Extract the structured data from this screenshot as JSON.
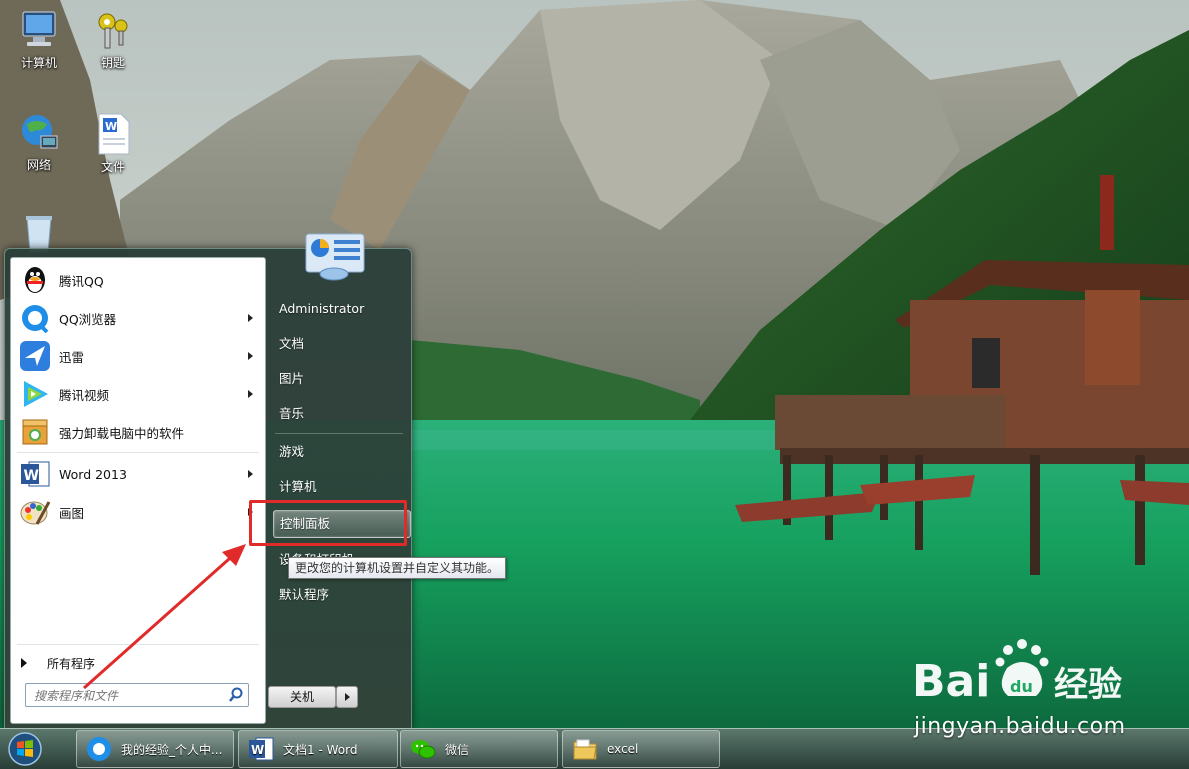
{
  "desktop": {
    "icons": [
      {
        "label": "计算机"
      },
      {
        "label": "钥匙"
      },
      {
        "label": "网络"
      },
      {
        "label": "文件"
      }
    ]
  },
  "start_menu": {
    "programs": [
      {
        "label": "腾讯QQ",
        "has_submenu": false
      },
      {
        "label": "QQ浏览器",
        "has_submenu": true
      },
      {
        "label": "迅雷",
        "has_submenu": true
      },
      {
        "label": "腾讯视频",
        "has_submenu": true
      },
      {
        "label": "强力卸载电脑中的软件",
        "has_submenu": false
      },
      {
        "label": "Word 2013",
        "has_submenu": true
      },
      {
        "label": "画图",
        "has_submenu": true
      }
    ],
    "all_programs": "所有程序",
    "search_placeholder": "搜索程序和文件",
    "right_items": [
      {
        "label": "Administrator"
      },
      {
        "label": "文档"
      },
      {
        "label": "图片"
      },
      {
        "label": "音乐"
      },
      {
        "label": "游戏"
      },
      {
        "label": "计算机"
      },
      {
        "label": "控制面板",
        "hovered": true
      },
      {
        "label": "设备和打印机"
      },
      {
        "label": "默认程序"
      }
    ],
    "shutdown_label": "关机",
    "tooltip": "更改您的计算机设置并自定义其功能。"
  },
  "taskbar": {
    "tasks": [
      {
        "label": "我的经验_个人中...",
        "icon": "qq-browser-icon"
      },
      {
        "label": "文档1 - Word",
        "icon": "word-icon"
      },
      {
        "label": "微信",
        "icon": "wechat-icon"
      },
      {
        "label": "excel",
        "icon": "folder-icon"
      }
    ]
  },
  "watermark": {
    "url": "jingyan.baidu.com"
  },
  "colors": {
    "highlight_box": "#e12a2a",
    "annotation_arrow": "#e12a2a"
  }
}
